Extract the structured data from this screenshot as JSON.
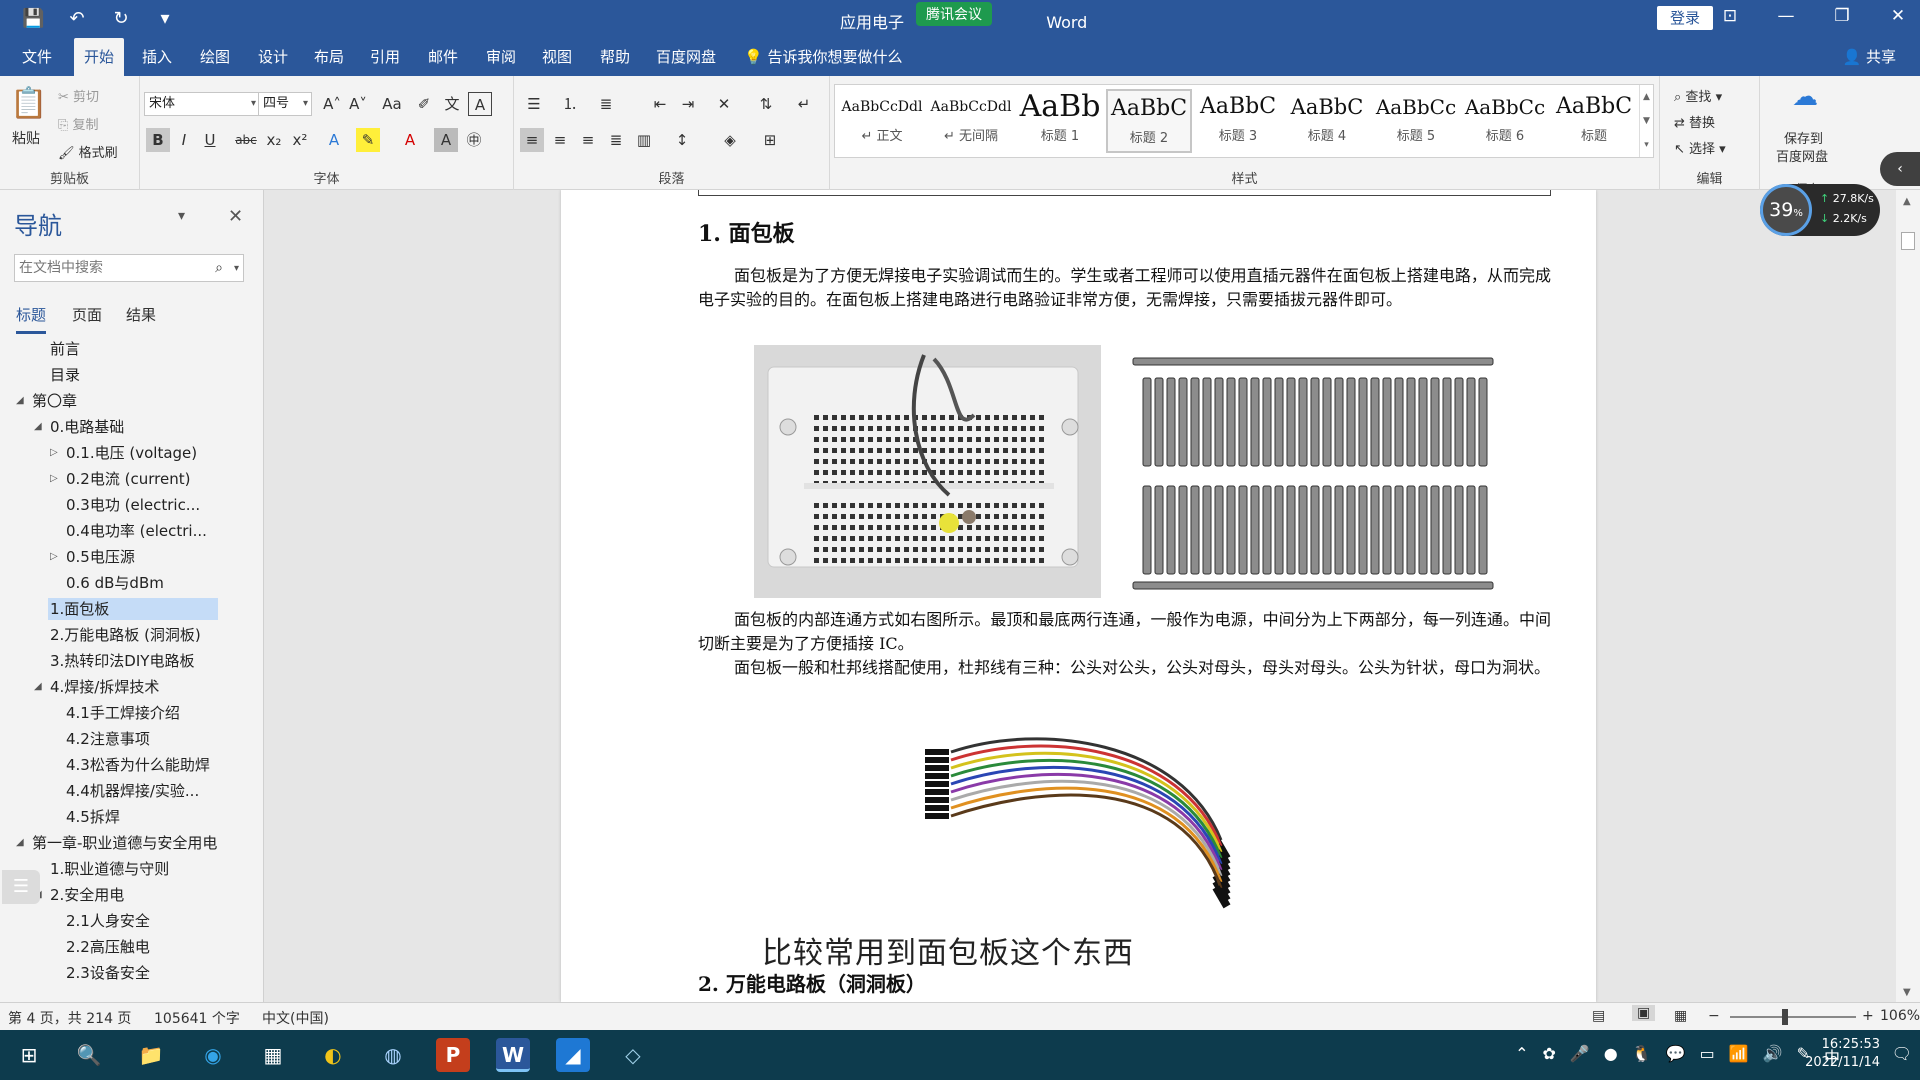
{
  "window": {
    "title_prefix": "应用电子",
    "title_suffix": "Word",
    "meeting_badge": "腾讯会议",
    "login": "登录",
    "controls": [
      "⊡",
      "—",
      "❐",
      "✕"
    ]
  },
  "quick_access": [
    "💾",
    "↶",
    "↻",
    "▾"
  ],
  "menu": {
    "tabs": [
      "文件",
      "开始",
      "插入",
      "绘图",
      "设计",
      "布局",
      "引用",
      "邮件",
      "审阅",
      "视图",
      "帮助",
      "百度网盘"
    ],
    "active": "开始",
    "tell_me": "告诉我你想要做什么",
    "share": "共享"
  },
  "ribbon": {
    "clipboard": {
      "paste": "粘贴",
      "cut": "剪切",
      "copy": "复制",
      "format_painter": "格式刷",
      "label": "剪贴板"
    },
    "font": {
      "name": "宋体",
      "size": "四号",
      "label": "字体"
    },
    "paragraph": {
      "label": "段落"
    },
    "styles": {
      "label": "样式",
      "items": [
        {
          "preview": "AaBbCcDdl",
          "name": "↵ 正文"
        },
        {
          "preview": "AaBbCcDdl",
          "name": "↵ 无间隔"
        },
        {
          "preview": "AaBb",
          "name": "标题 1"
        },
        {
          "preview": "AaBbC",
          "name": "标题 2"
        },
        {
          "preview": "AaBbC",
          "name": "标题 3"
        },
        {
          "preview": "AaBbC",
          "name": "标题 4"
        },
        {
          "preview": "AaBbCc",
          "name": "标题 5"
        },
        {
          "preview": "AaBbCc",
          "name": "标题 6"
        },
        {
          "preview": "AaBbC",
          "name": "标题"
        }
      ]
    },
    "editing": {
      "find": "查找",
      "replace": "替换",
      "select": "选择",
      "label": "编辑"
    },
    "save_cloud": {
      "line1": "保存到",
      "line2": "百度网盘",
      "label": "保存"
    }
  },
  "nav": {
    "title": "导航",
    "search_placeholder": "在文档中搜索",
    "tabs": [
      "标题",
      "页面",
      "结果"
    ],
    "items": [
      {
        "label": "前言",
        "level": 1,
        "tri": ""
      },
      {
        "label": "目录",
        "level": 1,
        "tri": ""
      },
      {
        "label": "第〇章",
        "level": 0,
        "tri": "◢"
      },
      {
        "label": "0.电路基础",
        "level": 1,
        "tri": "◢"
      },
      {
        "label": "0.1.电压 (voltage)",
        "level": 2,
        "tri": "▷"
      },
      {
        "label": "0.2电流 (current)",
        "level": 2,
        "tri": "▷"
      },
      {
        "label": "0.3电功 (electric...",
        "level": 2,
        "tri": ""
      },
      {
        "label": "0.4电功率 (electri...",
        "level": 2,
        "tri": ""
      },
      {
        "label": "0.5电压源",
        "level": 2,
        "tri": "▷"
      },
      {
        "label": "0.6 dB与dBm",
        "level": 2,
        "tri": ""
      },
      {
        "label": "1.面包板",
        "level": 1,
        "tri": "",
        "selected": true
      },
      {
        "label": "2.万能电路板 (洞洞板)",
        "level": 1,
        "tri": ""
      },
      {
        "label": "3.热转印法DIY电路板",
        "level": 1,
        "tri": ""
      },
      {
        "label": "4.焊接/拆焊技术",
        "level": 1,
        "tri": "◢"
      },
      {
        "label": "4.1手工焊接介绍",
        "level": 2,
        "tri": ""
      },
      {
        "label": "4.2注意事项",
        "level": 2,
        "tri": ""
      },
      {
        "label": "4.3松香为什么能助焊",
        "level": 2,
        "tri": ""
      },
      {
        "label": "4.4机器焊接/实验...",
        "level": 2,
        "tri": ""
      },
      {
        "label": "4.5拆焊",
        "level": 2,
        "tri": ""
      },
      {
        "label": "第一章-职业道德与安全用电",
        "level": 0,
        "tri": "◢"
      },
      {
        "label": "1.职业道德与守则",
        "level": 1,
        "tri": ""
      },
      {
        "label": "2.安全用电",
        "level": 1,
        "tri": "◢"
      },
      {
        "label": "2.1人身安全",
        "level": 2,
        "tri": ""
      },
      {
        "label": "2.2高压触电",
        "level": 2,
        "tri": ""
      },
      {
        "label": "2.3设备安全",
        "level": 2,
        "tri": ""
      }
    ]
  },
  "document": {
    "heading1": "1. 面包板",
    "para1": "面包板是为了方便无焊接电子实验调试而生的。学生或者工程师可以使用直插元器件在面包板上搭建电路，从而完成电子实验的目的。在面包板上搭建电路进行电路验证非常方便，无需焊接，只需要插拔元器件即可。",
    "para2": "面包板的内部连通方式如右图所示。最顶和最底两行连通，一般作为电源，中间分为上下两部分，每一列连通。中间切断主要是为了方便插接 IC。",
    "para3": "面包板一般和杜邦线搭配使用，杜邦线有三种：公头对公头，公头对母头，母头对母头。公头为针状，母口为洞状。",
    "heading2": "2. 万能电路板（洞洞板）",
    "subtitle": "比较常用到面包板这个东西"
  },
  "status": {
    "page": "第 4 页，共 214 页",
    "words": "105641 个字",
    "lang": "中文(中国)",
    "zoom": "106%"
  },
  "net_widget": {
    "percent": "39",
    "up": "27.8K/s",
    "down": "2.2K/s"
  },
  "taskbar": {
    "apps": [
      "⊞",
      "🔍",
      "📁",
      "◉",
      "▦",
      "◐",
      "◍",
      "P",
      "W",
      "◢",
      "◇"
    ],
    "tray": [
      "⌃",
      "✿",
      "🎤",
      "●",
      "🐧",
      "💬",
      "▭",
      "📶",
      "🔊",
      "✎",
      "中"
    ],
    "time": "16:25:53",
    "date": "2022/11/14",
    "notif": "🗨"
  }
}
